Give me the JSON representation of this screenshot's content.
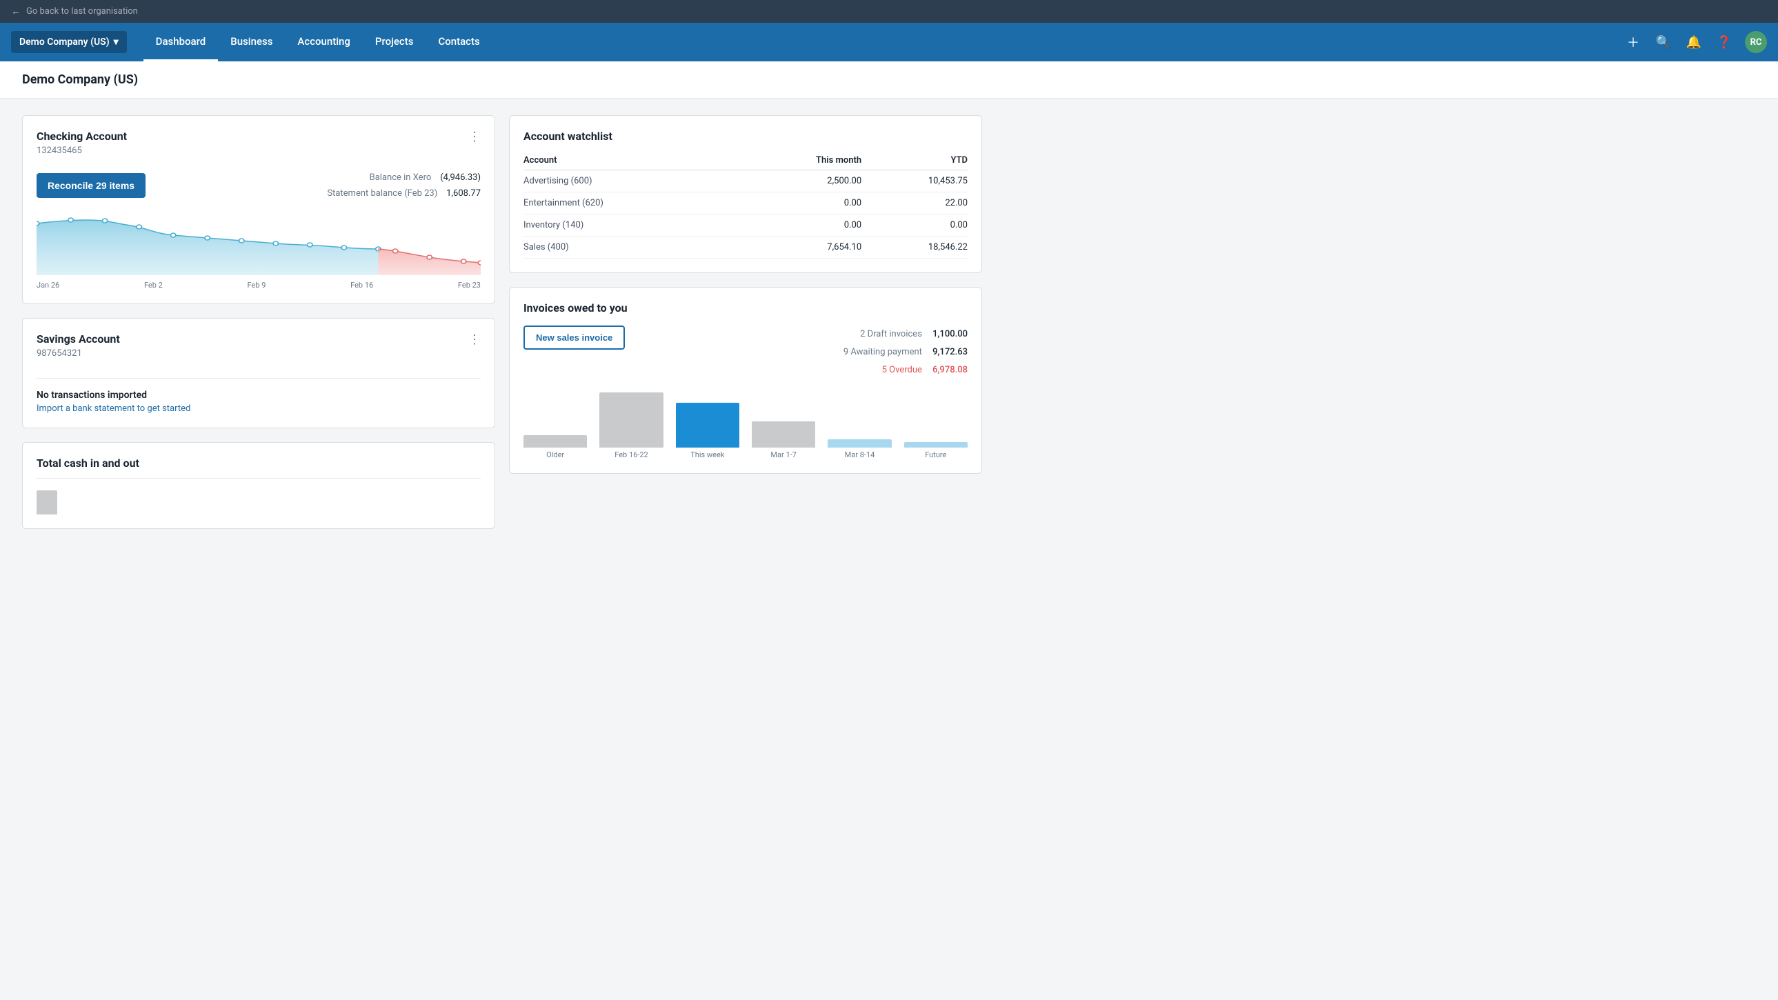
{
  "topbar": {
    "back_label": "Go back to last organisation"
  },
  "nav": {
    "company": "Demo Company (US)",
    "links": [
      {
        "label": "Dashboard",
        "active": true
      },
      {
        "label": "Business",
        "active": false
      },
      {
        "label": "Accounting",
        "active": false
      },
      {
        "label": "Projects",
        "active": false
      },
      {
        "label": "Contacts",
        "active": false
      }
    ],
    "avatar": "RC"
  },
  "page_title": "Demo Company (US)",
  "checking_account": {
    "title": "Checking Account",
    "account_number": "132435465",
    "reconcile_label": "Reconcile 29 items",
    "balance_in_xero_label": "Balance in Xero",
    "balance_in_xero_value": "(4,946.33)",
    "statement_balance_label": "Statement balance (Feb 23)",
    "statement_balance_value": "1,608.77",
    "chart_labels": [
      "Jan 26",
      "Feb 2",
      "Feb 9",
      "Feb 16",
      "Feb 23"
    ]
  },
  "savings_account": {
    "title": "Savings Account",
    "account_number": "987654321",
    "no_transactions_label": "No transactions imported",
    "import_link_label": "Import a bank statement to get started"
  },
  "total_cash": {
    "title": "Total cash in and out"
  },
  "account_watchlist": {
    "title": "Account watchlist",
    "col_account": "Account",
    "col_this_month": "This month",
    "col_ytd": "YTD",
    "rows": [
      {
        "account": "Advertising (600)",
        "this_month": "2,500.00",
        "ytd": "10,453.75"
      },
      {
        "account": "Entertainment (620)",
        "this_month": "0.00",
        "ytd": "22.00"
      },
      {
        "account": "Inventory (140)",
        "this_month": "0.00",
        "ytd": "0.00"
      },
      {
        "account": "Sales (400)",
        "this_month": "7,654.10",
        "ytd": "18,546.22"
      }
    ]
  },
  "invoices_owed": {
    "title": "Invoices owed to you",
    "new_invoice_btn_label": "New sales invoice",
    "draft_label": "2 Draft invoices",
    "draft_amount": "1,100.00",
    "awaiting_label": "9 Awaiting payment",
    "awaiting_amount": "9,172.63",
    "overdue_label": "5 Overdue",
    "overdue_amount": "6,978.08",
    "chart_bars": [
      {
        "label": "Older",
        "height": 18,
        "color": "#c8cacc"
      },
      {
        "label": "Feb 16-22",
        "height": 80,
        "color": "#c8cacc"
      },
      {
        "label": "This week",
        "height": 65,
        "color": "#1b8dd4"
      },
      {
        "label": "Mar 1-7",
        "height": 38,
        "color": "#c8cacc"
      },
      {
        "label": "Mar 8-14",
        "height": 12,
        "color": "#a8d8f0"
      },
      {
        "label": "Future",
        "height": 8,
        "color": "#a8d8f0"
      }
    ]
  }
}
